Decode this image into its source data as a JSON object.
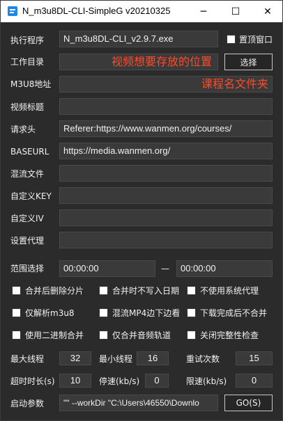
{
  "window": {
    "title": "N_m3u8DL-CLI-SimpleG v20210325",
    "minimize_glyph": "─",
    "maximize_glyph": "☐",
    "close_glyph": "✕"
  },
  "labels": {
    "exe": "执行程序",
    "workdir": "工作目录",
    "m3u8": "M3U8地址",
    "video_title": "视频标题",
    "headers": "请求头",
    "baseurl": "BASEURL",
    "mux_file": "混流文件",
    "custom_key": "自定义KEY",
    "custom_iv": "自定义IV",
    "proxy": "设置代理",
    "range": "范围选择",
    "range_sep": "—",
    "max_threads": "最大线程",
    "min_threads": "最小线程",
    "retry": "重试次数",
    "timeout": "超时时长(s)",
    "stop_speed": "停速(kb/s)",
    "limit_speed": "限速(kb/s)",
    "launch_args": "启动参数"
  },
  "fields": {
    "exe_value": "N_m3u8DL-CLI_v2.9.7.exe",
    "workdir_value": "",
    "m3u8_value": "",
    "video_title_value": "",
    "headers_value": "Referer:https://www.wanmen.org/courses/",
    "baseurl_value": "https://media.wanmen.org/",
    "mux_file_value": "",
    "custom_key_value": "",
    "custom_iv_value": "",
    "proxy_value": "",
    "range_start": "00:00:00",
    "range_end": "00:00:00",
    "max_threads_value": "32",
    "min_threads_value": "16",
    "retry_value": "15",
    "timeout_value": "10",
    "stop_speed_value": "0",
    "limit_speed_value": "0",
    "launch_args_value": "\"\" --workDir \"C:\\Users\\46550\\Downlo"
  },
  "annotations": {
    "workdir_hint": "视频想要存放的位置",
    "m3u8_hint": "课程名文件夹"
  },
  "buttons": {
    "choose": "选择",
    "go": "GO(S)"
  },
  "options": {
    "topmost": "置顶窗口",
    "delete_after_merge": "合并后删除分片",
    "no_date_on_merge": "合并时不写入日期",
    "no_system_proxy": "不使用系统代理",
    "parse_only": "仅解析m3u8",
    "mux_mp4_while_download": "混流MP4边下边看",
    "no_merge_after_download": "下载完成后不合并",
    "binary_merge": "使用二进制合并",
    "audio_only": "仅合并音频轨道",
    "disable_integrity_check": "关闭完整性检查"
  },
  "colors": {
    "background": "#2b2b2b",
    "field": "#3a3a3a",
    "annotation_red": "#ff4a2a"
  }
}
